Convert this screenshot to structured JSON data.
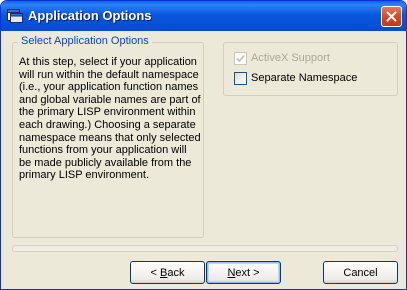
{
  "window": {
    "title": "Application Options",
    "app_icon": "app-window-icon",
    "close_icon": "close-icon",
    "title_gradient_color": "#0a58e0",
    "close_color": "#d2431f"
  },
  "group": {
    "legend": "Select Application Options",
    "description": "At this step, select if your application will run within the default namespace (i.e., your application function names and global variable names are part of the primary LISP environment within each drawing.)  Choosing a separate namespace means that only selected functions from your application will be made publicly available from the primary LISP environment."
  },
  "options": [
    {
      "label": "ActiveX Support",
      "checked": true,
      "enabled": false
    },
    {
      "label": "Separate Namespace",
      "checked": false,
      "enabled": true
    }
  ],
  "buttons": {
    "back": {
      "prefix": "< ",
      "mnemonic": "B",
      "rest": "ack"
    },
    "next": {
      "mnemonic": "N",
      "rest": "ext >"
    },
    "cancel": "Cancel"
  },
  "colors": {
    "dialog_bg": "#ece9d8",
    "legend": "#0046d5",
    "disabled_text": "#aca899"
  }
}
